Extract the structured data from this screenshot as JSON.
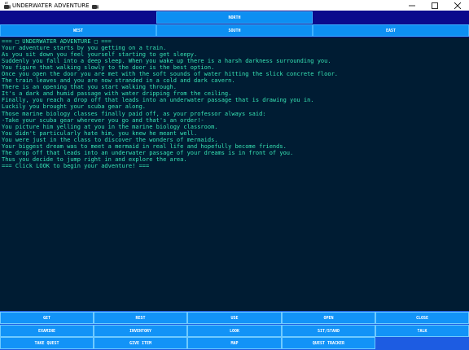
{
  "window": {
    "title": "UNDERWATER ADVENTURE",
    "controls": {
      "minimize": "—",
      "maximize": "☐",
      "close": "✕"
    }
  },
  "nav": {
    "north": "NORTH",
    "west": "WEST",
    "south": "SOUTH",
    "east": "EAST"
  },
  "console": {
    "lines": [
      "=== □ UNDERWATER ADVENTURE □ ===",
      "Your adventure starts by you getting on a train.",
      "As you sit down you feel yourself starting to get sleepy.",
      "Suddenly you fall into a deep sleep. When you wake up there is a harsh darkness surrounding you.",
      "You figure that walking slowly to the door is the best option.",
      "Once you open the door you are met with the soft sounds of water hitting the slick concrete floor.",
      "The train leaves and you are now stranded in a cold and dark cavern.",
      "There is an opening that you start walking through.",
      "It's a dark and humid passage with water dripping from the ceiling.",
      "Finally, you reach a drop off that leads into an underwater passage that is drawing you in.",
      "Luckily you brought your scuba gear along.",
      "Those marine biology classes finally paid off, as your professor always said:",
      "-Take your scuba gear wherever you go and that's an order!-",
      "You picture him yelling at you in the marine biology classroom.",
      "You didn't particularly hate him, you knew he meant well.",
      "You were just in the class to discover the wonders of mermaids.",
      "Your biggest dream was to meet a mermaid in real life and hopefully become friends.",
      "The drop off that leads into an underwater passage of your dreams is in front of you.",
      "Thus you decide to jump right in and explore the area.",
      "=== Click LOOK to begin your adventure! ==="
    ]
  },
  "actions": {
    "get": "GET",
    "rest": "REST",
    "use": "USE",
    "open": "OPEN",
    "close": "CLOSE",
    "examine": "EXAMINE",
    "inventory": "INVENTORY",
    "look": "LOOK",
    "sit_stand": "SIT/STAND",
    "talk": "TALK",
    "take_quest": "TAKE QUEST",
    "give_item": "GIVE ITEM",
    "map": "MAP",
    "quest_tracker": "QUEST TRACKER"
  },
  "colors": {
    "console_bg": "#001c33",
    "console_text": "#36e4b4",
    "button": "#0d8ff2",
    "nav_bg": "#0a0a8c",
    "actions_bg": "#1d5ce2"
  }
}
